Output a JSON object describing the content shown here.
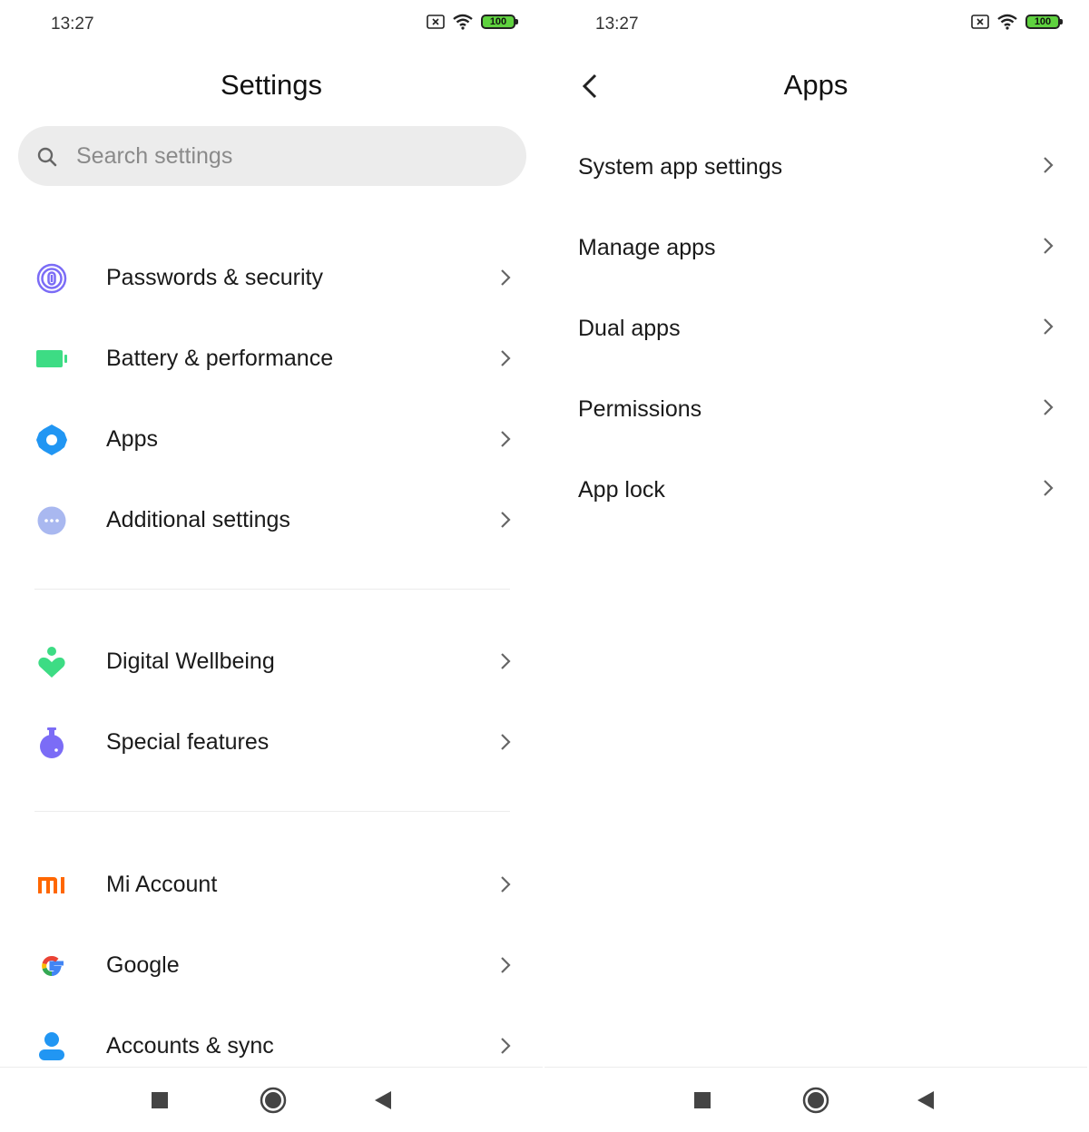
{
  "left": {
    "status": {
      "time": "13:27",
      "battery": "100"
    },
    "title": "Settings",
    "search": {
      "placeholder": "Search settings"
    },
    "groups": [
      [
        {
          "label": "Passwords & security",
          "icon": "fingerprint-icon"
        },
        {
          "label": "Battery & performance",
          "icon": "battery-icon"
        },
        {
          "label": "Apps",
          "icon": "gear-icon"
        },
        {
          "label": "Additional settings",
          "icon": "more-dots-icon"
        }
      ],
      [
        {
          "label": "Digital Wellbeing",
          "icon": "wellbeing-heart-icon"
        },
        {
          "label": "Special features",
          "icon": "flask-icon"
        }
      ],
      [
        {
          "label": "Mi Account",
          "icon": "mi-logo-icon"
        },
        {
          "label": "Google",
          "icon": "google-g-icon"
        },
        {
          "label": "Accounts & sync",
          "icon": "person-icon"
        }
      ]
    ]
  },
  "right": {
    "status": {
      "time": "13:27",
      "battery": "100"
    },
    "title": "Apps",
    "items": [
      {
        "label": "System app settings"
      },
      {
        "label": "Manage apps"
      },
      {
        "label": "Dual apps"
      },
      {
        "label": "Permissions"
      },
      {
        "label": "App lock"
      }
    ]
  },
  "colors": {
    "battery_green": "#5fd23f",
    "fingerprint_purple": "#7b6cf6",
    "battery_icon_green": "#3ddc84",
    "gear_blue": "#2196f3",
    "dots_lavender": "#a9b8f0",
    "wellbeing_green": "#3ddc84",
    "flask_purple": "#7b6cf6",
    "mi_orange": "#ff6700",
    "person_blue": "#2196f3"
  }
}
